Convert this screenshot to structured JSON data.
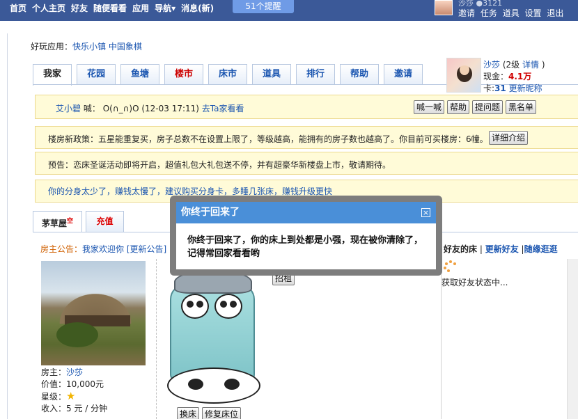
{
  "topnav": [
    "首页",
    "个人主页",
    "好友",
    "随便看看",
    "应用",
    "导航▾",
    "消息(新)"
  ],
  "reminder": "51个提醒",
  "topuser": {
    "name": "沙莎",
    "coins": "3121",
    "links": [
      "邀请",
      "任务",
      "道具",
      "设置",
      "退出"
    ]
  },
  "games": {
    "label": "好玩应用：",
    "items": [
      "快乐小镇",
      "中国象棋"
    ]
  },
  "tabs": [
    "我家",
    "花园",
    "鱼塘",
    "楼市",
    "床市",
    "道具",
    "排行",
    "帮助",
    "邀请"
  ],
  "profile": {
    "name": "沙莎",
    "level": "(2级",
    "detail": "详情",
    "close": ")",
    "cash_label": "现金：",
    "cash": "4.1万",
    "card_label": "卡:",
    "card": "31",
    "rename": "更新昵称"
  },
  "shout": {
    "who": "艾小碧",
    "says": "喊：",
    "text": "O(∩_∩)O (12-03 17:11)",
    "link": "去Ta家看看"
  },
  "shout_buttons": [
    "喊一喊",
    "帮助",
    "提问题",
    "黑名单"
  ],
  "policy": {
    "text": "楼房新政策：五星能重复买，房子总数不在设置上限了，等级越高，能拥有的房子数也越高了。你目前可买楼房：6幢。",
    "button": "详细介绍"
  },
  "preview": "预告：恋床圣诞活动即将开启，超值礼包大礼包送不停，并有超豪华新楼盘上市，敬请期待。",
  "tip": "你的分身太少了，赚钱太慢了，建议购买分身卡，多睡几张床，赚钱升级更快",
  "subtabs": {
    "hut": "茅草屋",
    "hut_sup": "空",
    "recharge": "充值"
  },
  "notice": {
    "label": "房主公告：",
    "text": "我家欢迎你",
    "update": "[更新公告]"
  },
  "house_info": {
    "owner_label": "房主：",
    "owner": "沙莎",
    "value": "价值：10,000元",
    "star_label": "星级：",
    "star": "★",
    "income": "收入：5 元 / 分钟"
  },
  "bed_buttons": [
    "换床",
    "修复床位"
  ],
  "zhaozu": "招租",
  "friends": {
    "title": "好友的床",
    "sep": " | ",
    "update": "更新好友",
    "sep2": " |",
    "random": "随缘逛逛",
    "loading": "获取好友状态中..."
  },
  "modal": {
    "title": "你终于回来了",
    "close": "×",
    "text": "你终于回来了，你的床上到处都是小强，现在被你清除了，记得常回家看看哟"
  },
  "colors": {
    "topbar": "#3b5998",
    "accent_red": "#d00000",
    "link": "#1a55b0",
    "modal_header": "#4a8fd8"
  }
}
